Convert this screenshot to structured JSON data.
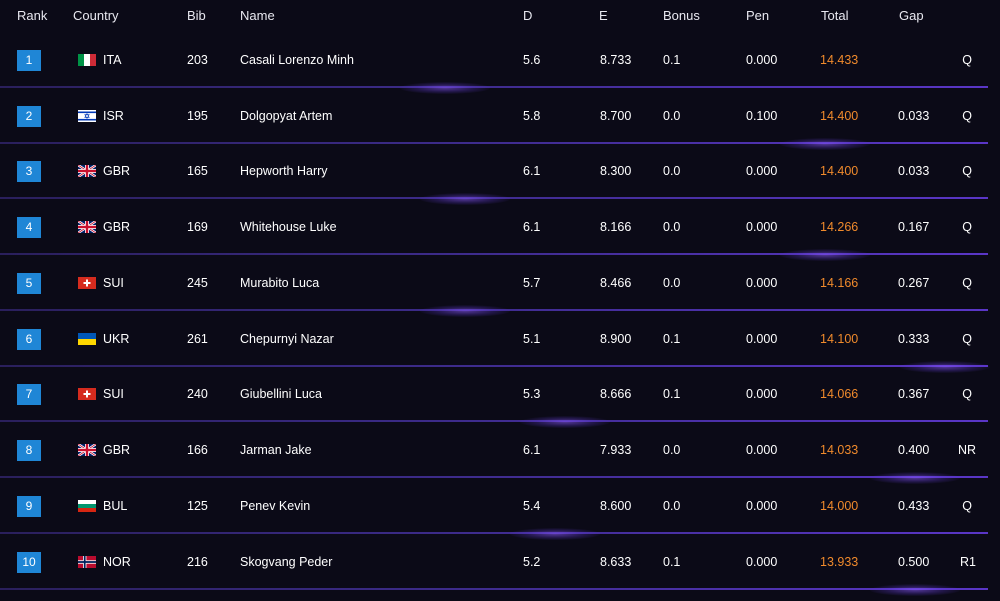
{
  "headers": {
    "rank": "Rank",
    "country": "Country",
    "bib": "Bib",
    "name": "Name",
    "d": "D",
    "e": "E",
    "bonus": "Bonus",
    "pen": "Pen",
    "total": "Total",
    "gap": "Gap"
  },
  "colors": {
    "background": "#0b0a17",
    "rank_badge": "#1f86d6",
    "total_text": "#f08a2c",
    "divider": "#5a36c7"
  },
  "rows": [
    {
      "rank": "1",
      "country": "ITA",
      "flag": "italy-flag-icon",
      "bib": "203",
      "name": "Casali Lorenzo Minh",
      "d": "5.6",
      "e": "8.733",
      "bonus": "0.1",
      "pen": "0.000",
      "total": "14.433",
      "gap": "",
      "q": "Q"
    },
    {
      "rank": "2",
      "country": "ISR",
      "flag": "israel-flag-icon",
      "bib": "195",
      "name": "Dolgopyat Artem",
      "d": "5.8",
      "e": "8.700",
      "bonus": "0.0",
      "pen": "0.100",
      "total": "14.400",
      "gap": "0.033",
      "q": "Q"
    },
    {
      "rank": "3",
      "country": "GBR",
      "flag": "uk-flag-icon",
      "bib": "165",
      "name": "Hepworth Harry",
      "d": "6.1",
      "e": "8.300",
      "bonus": "0.0",
      "pen": "0.000",
      "total": "14.400",
      "gap": "0.033",
      "q": "Q"
    },
    {
      "rank": "4",
      "country": "GBR",
      "flag": "uk-flag-icon",
      "bib": "169",
      "name": "Whitehouse Luke",
      "d": "6.1",
      "e": "8.166",
      "bonus": "0.0",
      "pen": "0.000",
      "total": "14.266",
      "gap": "0.167",
      "q": "Q"
    },
    {
      "rank": "5",
      "country": "SUI",
      "flag": "switzerland-flag-icon",
      "bib": "245",
      "name": "Murabito Luca",
      "d": "5.7",
      "e": "8.466",
      "bonus": "0.0",
      "pen": "0.000",
      "total": "14.166",
      "gap": "0.267",
      "q": "Q"
    },
    {
      "rank": "6",
      "country": "UKR",
      "flag": "ukraine-flag-icon",
      "bib": "261",
      "name": "Chepurnyi Nazar",
      "d": "5.1",
      "e": "8.900",
      "bonus": "0.1",
      "pen": "0.000",
      "total": "14.100",
      "gap": "0.333",
      "q": "Q"
    },
    {
      "rank": "7",
      "country": "SUI",
      "flag": "switzerland-flag-icon",
      "bib": "240",
      "name": "Giubellini Luca",
      "d": "5.3",
      "e": "8.666",
      "bonus": "0.1",
      "pen": "0.000",
      "total": "14.066",
      "gap": "0.367",
      "q": "Q"
    },
    {
      "rank": "8",
      "country": "GBR",
      "flag": "uk-flag-icon",
      "bib": "166",
      "name": "Jarman Jake",
      "d": "6.1",
      "e": "7.933",
      "bonus": "0.0",
      "pen": "0.000",
      "total": "14.033",
      "gap": "0.400",
      "q": "NR"
    },
    {
      "rank": "9",
      "country": "BUL",
      "flag": "bulgaria-flag-icon",
      "bib": "125",
      "name": "Penev Kevin",
      "d": "5.4",
      "e": "8.600",
      "bonus": "0.0",
      "pen": "0.000",
      "total": "14.000",
      "gap": "0.433",
      "q": "Q"
    },
    {
      "rank": "10",
      "country": "NOR",
      "flag": "norway-flag-icon",
      "bib": "216",
      "name": "Skogvang Peder",
      "d": "5.2",
      "e": "8.633",
      "bonus": "0.1",
      "pen": "0.000",
      "total": "13.933",
      "gap": "0.500",
      "q": "R1"
    }
  ]
}
